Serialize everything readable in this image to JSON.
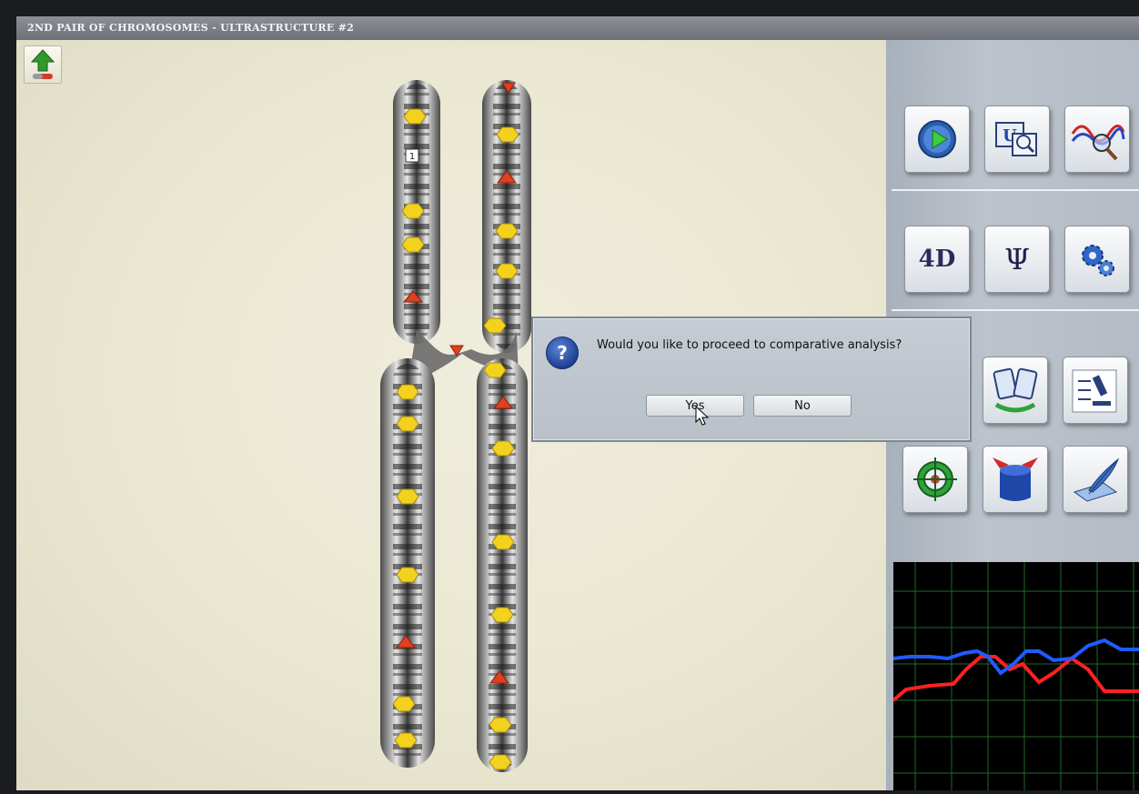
{
  "window": {
    "title": "2ND PAIR OF CHROMOSOMES - ULTRASTRUCTURE #2"
  },
  "chromosome": {
    "marker_label": "1"
  },
  "toolbar": {
    "row1": [
      "play-icon",
      "magnifier-compare-icon",
      "wave-search-icon"
    ],
    "row2": [
      "4D",
      "Ψ",
      "gears-icon"
    ],
    "row3": [
      "bookmarks-icon",
      "microscope-checklist-icon"
    ],
    "row4": [
      "target-icon",
      "cylinder-icon",
      "feather-pen-icon"
    ]
  },
  "dialog": {
    "message": "Would you like to proceed to comparative analysis?",
    "icon": "?",
    "yes_label": "Yes",
    "no_label": "No"
  },
  "colors": {
    "marker_yellow": "#f2d21e",
    "marker_red": "#e0401e",
    "graph_red": "#ff2020",
    "graph_blue": "#1f5cff",
    "graph_grid": "#1f6a2a"
  }
}
